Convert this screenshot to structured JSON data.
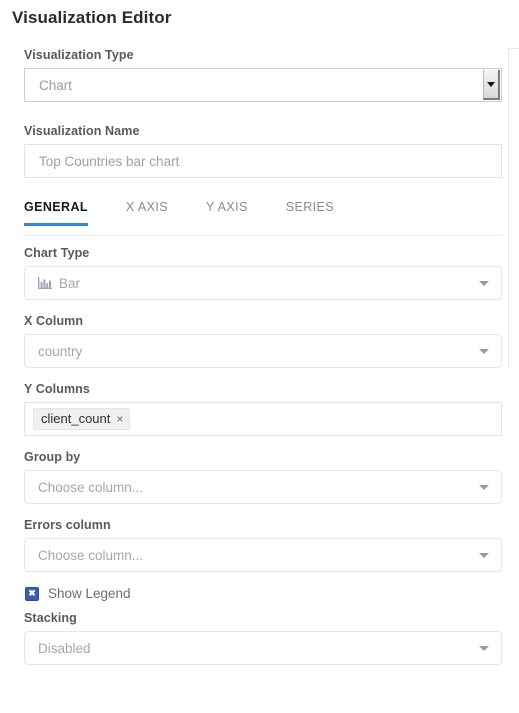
{
  "page": {
    "title": "Visualization Editor"
  },
  "visualization_type": {
    "label": "Visualization Type",
    "value": "Chart",
    "caret_icon": "chevron-down-icon"
  },
  "visualization_name": {
    "label": "Visualization Name",
    "placeholder": "Top Countries bar chart",
    "value": ""
  },
  "tabs": [
    {
      "label": "GENERAL",
      "active": true
    },
    {
      "label": "X AXIS",
      "active": false
    },
    {
      "label": "Y AXIS",
      "active": false
    },
    {
      "label": "SERIES",
      "active": false
    }
  ],
  "general": {
    "chart_type": {
      "label": "Chart Type",
      "value": "Bar",
      "icon": "bar-chart-icon"
    },
    "x_column": {
      "label": "X Column",
      "value": "country"
    },
    "y_columns": {
      "label": "Y Columns",
      "chips": [
        {
          "label": "client_count",
          "remove_icon": "close-icon",
          "remove_glyph": "×"
        }
      ]
    },
    "group_by": {
      "label": "Group by",
      "placeholder": "Choose column..."
    },
    "errors_column": {
      "label": "Errors column",
      "placeholder": "Choose column..."
    },
    "show_legend": {
      "label": "Show Legend",
      "checked": true,
      "check_glyph": "✖"
    },
    "stacking": {
      "label": "Stacking",
      "value": "Disabled"
    }
  },
  "colors": {
    "accent": "#2b8ae2",
    "checkbox": "#3b5bb5",
    "label_text": "#595959",
    "placeholder_text": "#a6a6a6",
    "title_text": "#2b2b2b"
  }
}
